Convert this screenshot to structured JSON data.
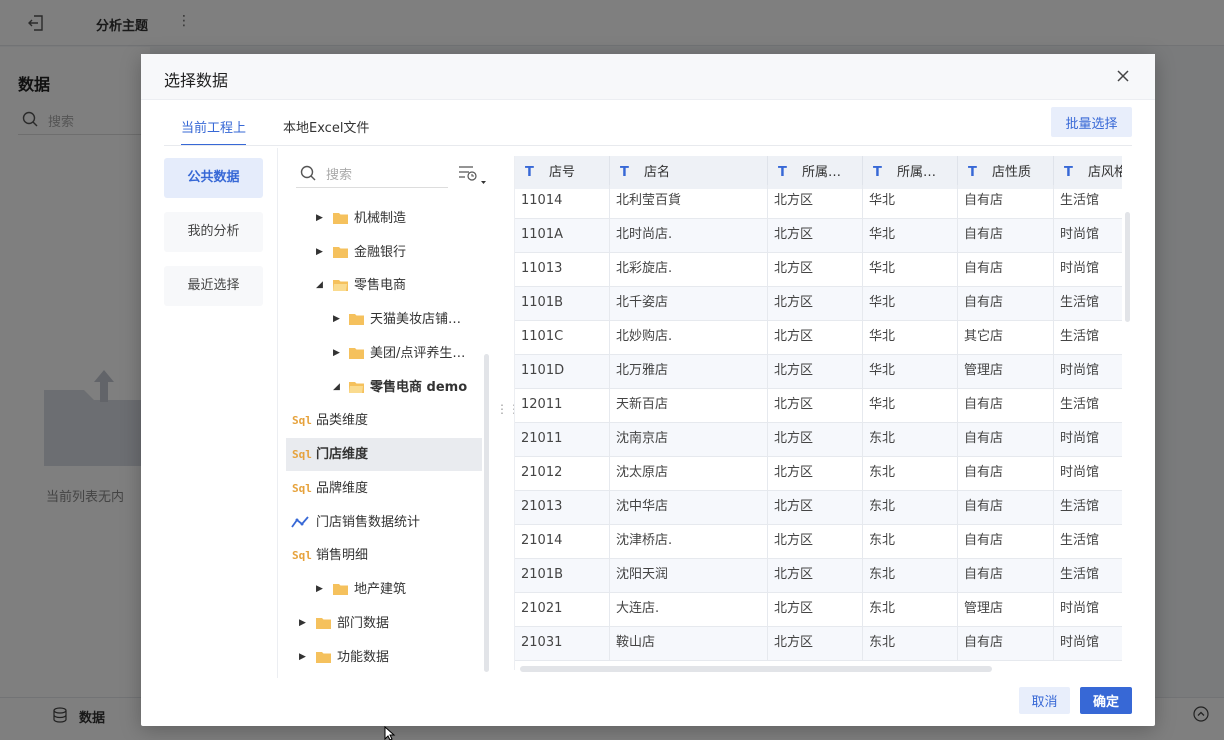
{
  "app": {
    "title": "分析主题",
    "left_title": "数据",
    "search_placeholder": "搜索",
    "empty_text": "当前列表无内",
    "bottom_label": "数据"
  },
  "dialog": {
    "title": "选择数据",
    "tabs": [
      {
        "label": "当前工程上",
        "active": true
      },
      {
        "label": "本地Excel文件",
        "active": false
      }
    ],
    "batch_select": "批量选择",
    "categories": [
      {
        "label": "公共数据",
        "active": true
      },
      {
        "label": "我的分析",
        "active": false
      },
      {
        "label": "最近选择",
        "active": false
      }
    ],
    "tree_search_placeholder": "搜索",
    "tree": [
      {
        "label": "机械制造",
        "type": "folder",
        "expanded": false
      },
      {
        "label": "金融银行",
        "type": "folder",
        "expanded": false
      },
      {
        "label": "零售电商",
        "type": "folder",
        "expanded": true
      },
      {
        "label": "天猫美妆店铺…",
        "type": "folder",
        "expanded": false
      },
      {
        "label": "美团/点评养生…",
        "type": "folder",
        "expanded": false
      },
      {
        "label": "零售电商 demo",
        "type": "folder",
        "expanded": true
      },
      {
        "label": "品类维度",
        "type": "sql"
      },
      {
        "label": "门店维度",
        "type": "sql",
        "selected": true
      },
      {
        "label": "品牌维度",
        "type": "sql"
      },
      {
        "label": "门店销售数据统计",
        "type": "line"
      },
      {
        "label": "销售明细",
        "type": "sql"
      },
      {
        "label": "地产建筑",
        "type": "folder",
        "expanded": false
      },
      {
        "label": "部门数据",
        "type": "folder",
        "expanded": false
      },
      {
        "label": "功能数据",
        "type": "folder",
        "expanded": false
      }
    ],
    "table": {
      "columns": [
        "店号",
        "店名",
        "所属…",
        "所属…",
        "店性质",
        "店风格"
      ],
      "rows": [
        [
          "11014",
          "北利莹百貨",
          "北方区",
          "华北",
          "自有店",
          "生活馆"
        ],
        [
          "1101A",
          "北时尚店.",
          "北方区",
          "华北",
          "自有店",
          "时尚馆"
        ],
        [
          "11013",
          "北彩旋店.",
          "北方区",
          "华北",
          "自有店",
          "时尚馆"
        ],
        [
          "1101B",
          "北千姿店",
          "北方区",
          "华北",
          "自有店",
          "生活馆"
        ],
        [
          "1101C",
          "北妙购店.",
          "北方区",
          "华北",
          "其它店",
          "生活馆"
        ],
        [
          "1101D",
          "北万雅店",
          "北方区",
          "华北",
          "管理店",
          "时尚馆"
        ],
        [
          "12011",
          "天新百店",
          "北方区",
          "华北",
          "自有店",
          "生活馆"
        ],
        [
          "21011",
          "沈南京店",
          "北方区",
          "东北",
          "自有店",
          "时尚馆"
        ],
        [
          "21012",
          "沈太原店",
          "北方区",
          "东北",
          "自有店",
          "时尚馆"
        ],
        [
          "21013",
          "沈中华店",
          "北方区",
          "东北",
          "自有店",
          "生活馆"
        ],
        [
          "21014",
          "沈津桥店.",
          "北方区",
          "东北",
          "自有店",
          "生活馆"
        ],
        [
          "2101B",
          "沈阳天润",
          "北方区",
          "东北",
          "自有店",
          "生活馆"
        ],
        [
          "21021",
          "大连店.",
          "北方区",
          "东北",
          "管理店",
          "时尚馆"
        ],
        [
          "21031",
          "鞍山店",
          "北方区",
          "东北",
          "自有店",
          "时尚馆"
        ]
      ]
    },
    "cancel": "取消",
    "confirm": "确定"
  },
  "colors": {
    "accent": "#3768d6",
    "sql_icon": "#e6a23c",
    "folder": "#f5c15d"
  }
}
